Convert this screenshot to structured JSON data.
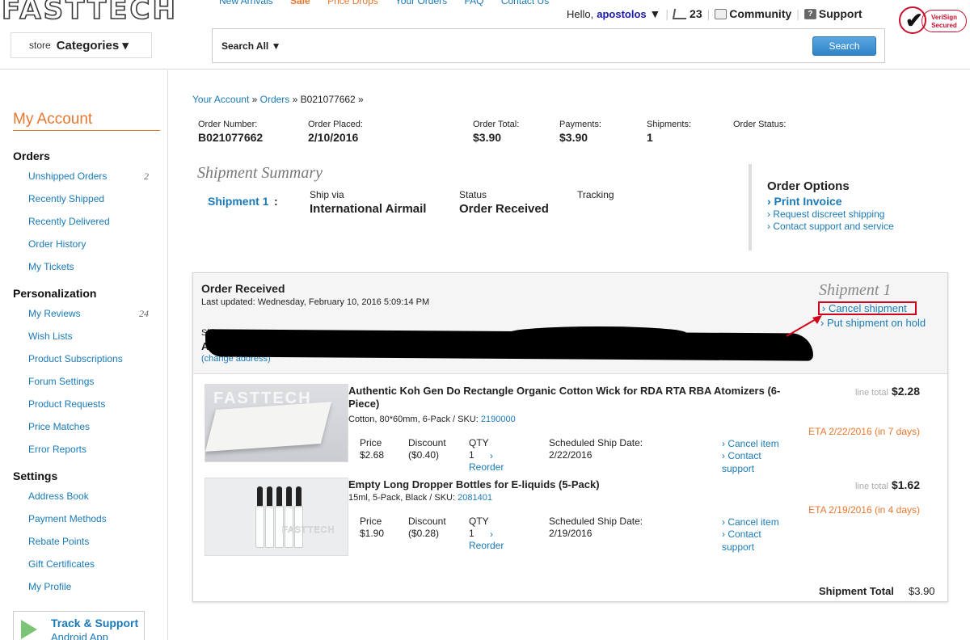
{
  "header": {
    "logo": "FASTTECH",
    "topnav": [
      "New Arrivals",
      "Sale",
      "Price Drops",
      "Your Orders",
      "FAQ",
      "Contact Us"
    ],
    "hello": "Hello,",
    "username": "apostolos",
    "cart_count": "23",
    "community": "Community",
    "support": "Support",
    "verisign_line1": "VeriSign",
    "verisign_line2": "Secured",
    "store_label": "store",
    "categories_label": "Categories ▾",
    "search_scope": "Search All ▼",
    "search_placeholder": "",
    "search_button": "Search"
  },
  "sidebar": {
    "title": "My Account",
    "orders_heading": "Orders",
    "orders_items": [
      {
        "label": "Unshipped Orders",
        "count": "2"
      },
      {
        "label": "Recently Shipped",
        "count": ""
      },
      {
        "label": "Recently Delivered",
        "count": ""
      },
      {
        "label": "Order History",
        "count": ""
      },
      {
        "label": "My Tickets",
        "count": ""
      }
    ],
    "personalization_heading": "Personalization",
    "personalization_items": [
      {
        "label": "My Reviews",
        "count": "24"
      },
      {
        "label": "Wish Lists",
        "count": ""
      },
      {
        "label": "Product Subscriptions",
        "count": ""
      },
      {
        "label": "Forum Settings",
        "count": ""
      },
      {
        "label": "Product Requests",
        "count": ""
      },
      {
        "label": "Price Matches",
        "count": ""
      },
      {
        "label": "Error Reports",
        "count": ""
      }
    ],
    "settings_heading": "Settings",
    "settings_items": [
      {
        "label": "Address Book"
      },
      {
        "label": "Payment Methods"
      },
      {
        "label": "Rebate Points"
      },
      {
        "label": "Gift Certificates"
      },
      {
        "label": "My Profile"
      }
    ],
    "track_title": "Track & Support",
    "track_sub": "Android App"
  },
  "breadcrumb": {
    "account": "Your Account",
    "sep1": " » ",
    "orders": "Orders",
    "sep2": " » ",
    "current": "B021077662 »"
  },
  "summary": {
    "order_number_label": "Order Number:",
    "order_number": "B021077662",
    "order_placed_label": "Order Placed:",
    "order_placed": "2/10/2016",
    "order_total_label": "Order Total:",
    "order_total": "$3.90",
    "payments_label": "Payments:",
    "payments": "$3.90",
    "shipments_label": "Shipments:",
    "shipments": "1",
    "order_status_label": "Order Status:",
    "order_status": ""
  },
  "shipment_summary": {
    "title": "Shipment Summary",
    "shipment_link": "Shipment 1",
    "colon": ":",
    "ship_via_label": "Ship via",
    "ship_via": "International Airmail",
    "status_label": "Status",
    "status": "Order Received",
    "tracking_label": "Tracking",
    "tracking": ""
  },
  "order_options": {
    "title": "Order Options",
    "print_invoice": "› Print Invoice",
    "discreet": "› Request discreet shipping",
    "contact": "› Contact support and service"
  },
  "shipment": {
    "status_title": "Order Received",
    "last_updated": "Last updated: Wednesday, February 10, 2016 5:09:14 PM",
    "ship_to_label": "Ship to:",
    "ship_to_name": "A",
    "change_address": "(change address)",
    "title": "Shipment 1",
    "cancel": "› Cancel shipment",
    "hold": "› Put shipment on hold",
    "total_label": "Shipment Total",
    "total": "$3.90"
  },
  "items": [
    {
      "name": "Authentic Koh Gen Do Rectangle Organic Cotton Wick for RDA RTA RBA Atomizers (6-Piece)",
      "variant": "Cotton, 80*60mm, 6-Pack / SKU: ",
      "sku": "2190000",
      "price_label": "Price",
      "price": "$2.68",
      "discount_label": "Discount",
      "discount": "($0.40)",
      "qty_label": "QTY",
      "qty": "1",
      "reorder_arrow": "›",
      "reorder": "Reorder",
      "ship_date_label": "Scheduled Ship Date:",
      "ship_date": "2/22/2016",
      "cancel_item": "› Cancel item",
      "contact": "› Contact",
      "contact2": "support",
      "line_total_label": "line total",
      "line_total": "$2.28",
      "eta": "ETA 2/22/2016 (in 7 days)",
      "thumb_text": "FASTTECH"
    },
    {
      "name": "Empty Long Dropper Bottles for E-liquids (5-Pack)",
      "variant": "15ml, 5-Pack, Black / SKU: ",
      "sku": "2081401",
      "price_label": "Price",
      "price": "$1.90",
      "discount_label": "Discount",
      "discount": "($0.28)",
      "qty_label": "QTY",
      "qty": "1",
      "reorder_arrow": "›",
      "reorder": "Reorder",
      "ship_date_label": "Scheduled Ship Date:",
      "ship_date": "2/19/2016",
      "cancel_item": "› Cancel item",
      "contact": "› Contact",
      "contact2": "support",
      "line_total_label": "line total",
      "line_total": "$1.62",
      "eta": "ETA 2/19/2016 (in 4 days)",
      "thumb_text": "FASTTECH"
    }
  ]
}
